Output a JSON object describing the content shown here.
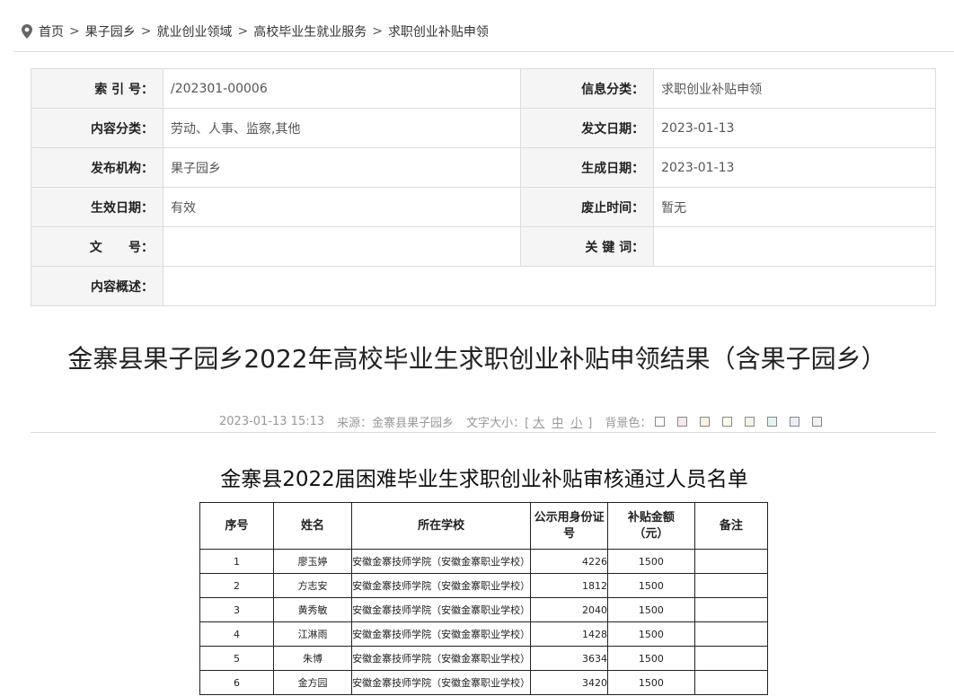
{
  "breadcrumb": {
    "items": [
      "首页",
      "果子园乡",
      "就业创业领域",
      "高校毕业生就业服务",
      "求职创业补贴申领"
    ],
    "separator": ">"
  },
  "meta": {
    "rows": [
      {
        "k1": "索 引 号：",
        "v1": "/202301-00006",
        "k2": "信息分类：",
        "v2": "求职创业补贴申领"
      },
      {
        "k1": "内容分类：",
        "v1": "劳动、人事、监察,其他",
        "k2": "发文日期：",
        "v2": "2023-01-13"
      },
      {
        "k1": "发布机构：",
        "v1": "果子园乡",
        "k2": "生成日期：",
        "v2": "2023-01-13"
      },
      {
        "k1": "生效日期：",
        "v1": "有效",
        "k2": "废止时间：",
        "v2": "暂无"
      },
      {
        "k1": "文      号：",
        "v1": "",
        "k2": "关 键 词：",
        "v2": ""
      }
    ],
    "summary_label": "内容概述：",
    "summary_value": ""
  },
  "article": {
    "title": "金寨县果子园乡2022年高校毕业生求职创业补贴申领结果（含果子园乡）",
    "datetime": "2023-01-13 15:13",
    "source": "来源：金寨县果子园乡",
    "font_size_label": "文字大小：[",
    "font_size_options": [
      "大",
      "中",
      "小"
    ],
    "font_size_close": "]",
    "bg_label": "背景色：",
    "bg_colors": [
      "#ffffff",
      "#fbe9e7",
      "#fdf2e4",
      "#fffde7",
      "#eef7e8",
      "#e3f6f5",
      "#e8eef8",
      "#f2f2f2"
    ]
  },
  "list": {
    "title": "金寨县2022届困难毕业生求职创业补贴审核通过人员名单",
    "headers": [
      "序号",
      "姓名",
      "所在学校",
      "公示用身份证号",
      "补贴金额（元）",
      "备注"
    ],
    "rows": [
      {
        "no": "1",
        "name": "廖玉婷",
        "school": "安徽金寨技师学院（安徽金寨职业学校）",
        "id": "4226",
        "amount": "1500",
        "note": ""
      },
      {
        "no": "2",
        "name": "方志安",
        "school": "安徽金寨技师学院（安徽金寨职业学校）",
        "id": "1812",
        "amount": "1500",
        "note": ""
      },
      {
        "no": "3",
        "name": "黄秀敏",
        "school": "安徽金寨技师学院（安徽金寨职业学校）",
        "id": "2040",
        "amount": "1500",
        "note": ""
      },
      {
        "no": "4",
        "name": "江淋雨",
        "school": "安徽金寨技师学院（安徽金寨职业学校）",
        "id": "1428",
        "amount": "1500",
        "note": ""
      },
      {
        "no": "5",
        "name": "朱博",
        "school": "安徽金寨技师学院（安徽金寨职业学校）",
        "id": "3634",
        "amount": "1500",
        "note": ""
      },
      {
        "no": "6",
        "name": "金方园",
        "school": "安徽金寨技师学院（安徽金寨职业学校）",
        "id": "3420",
        "amount": "1500",
        "note": ""
      }
    ]
  }
}
